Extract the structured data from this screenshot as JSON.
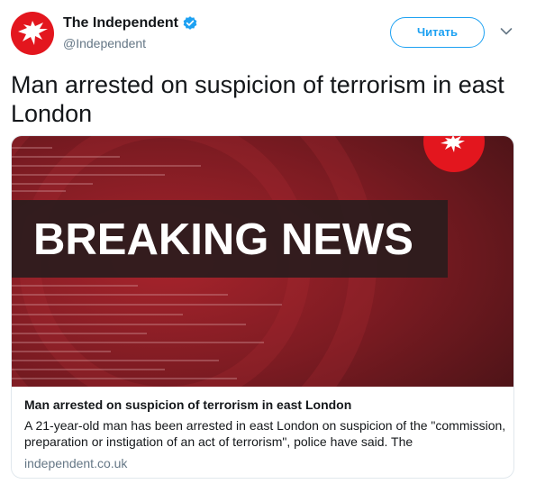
{
  "account": {
    "display_name": "The Independent",
    "handle": "@Independent",
    "verified": true,
    "avatar_icon": "independent-eagle-logo",
    "brand_color": "#e3161e"
  },
  "header": {
    "follow_label": "Читать",
    "menu_icon": "chevron-down-icon"
  },
  "tweet": {
    "text": "Man arrested on suspicion of terrorism in east London"
  },
  "card": {
    "image_text": "BREAKING NEWS",
    "image_logo_icon": "independent-eagle-logo",
    "title": "Man arrested on suspicion of terrorism in east London",
    "description": "A 21-year-old man has been arrested in east London on suspicion of the \"commission, preparation or instigation of an act of terrorism\", police have said. The",
    "domain": "independent.co.uk"
  },
  "colors": {
    "accent": "#1da1f2",
    "muted_text": "#657786",
    "card_border": "#e1e8ed",
    "image_red": "#7a1a1f"
  }
}
